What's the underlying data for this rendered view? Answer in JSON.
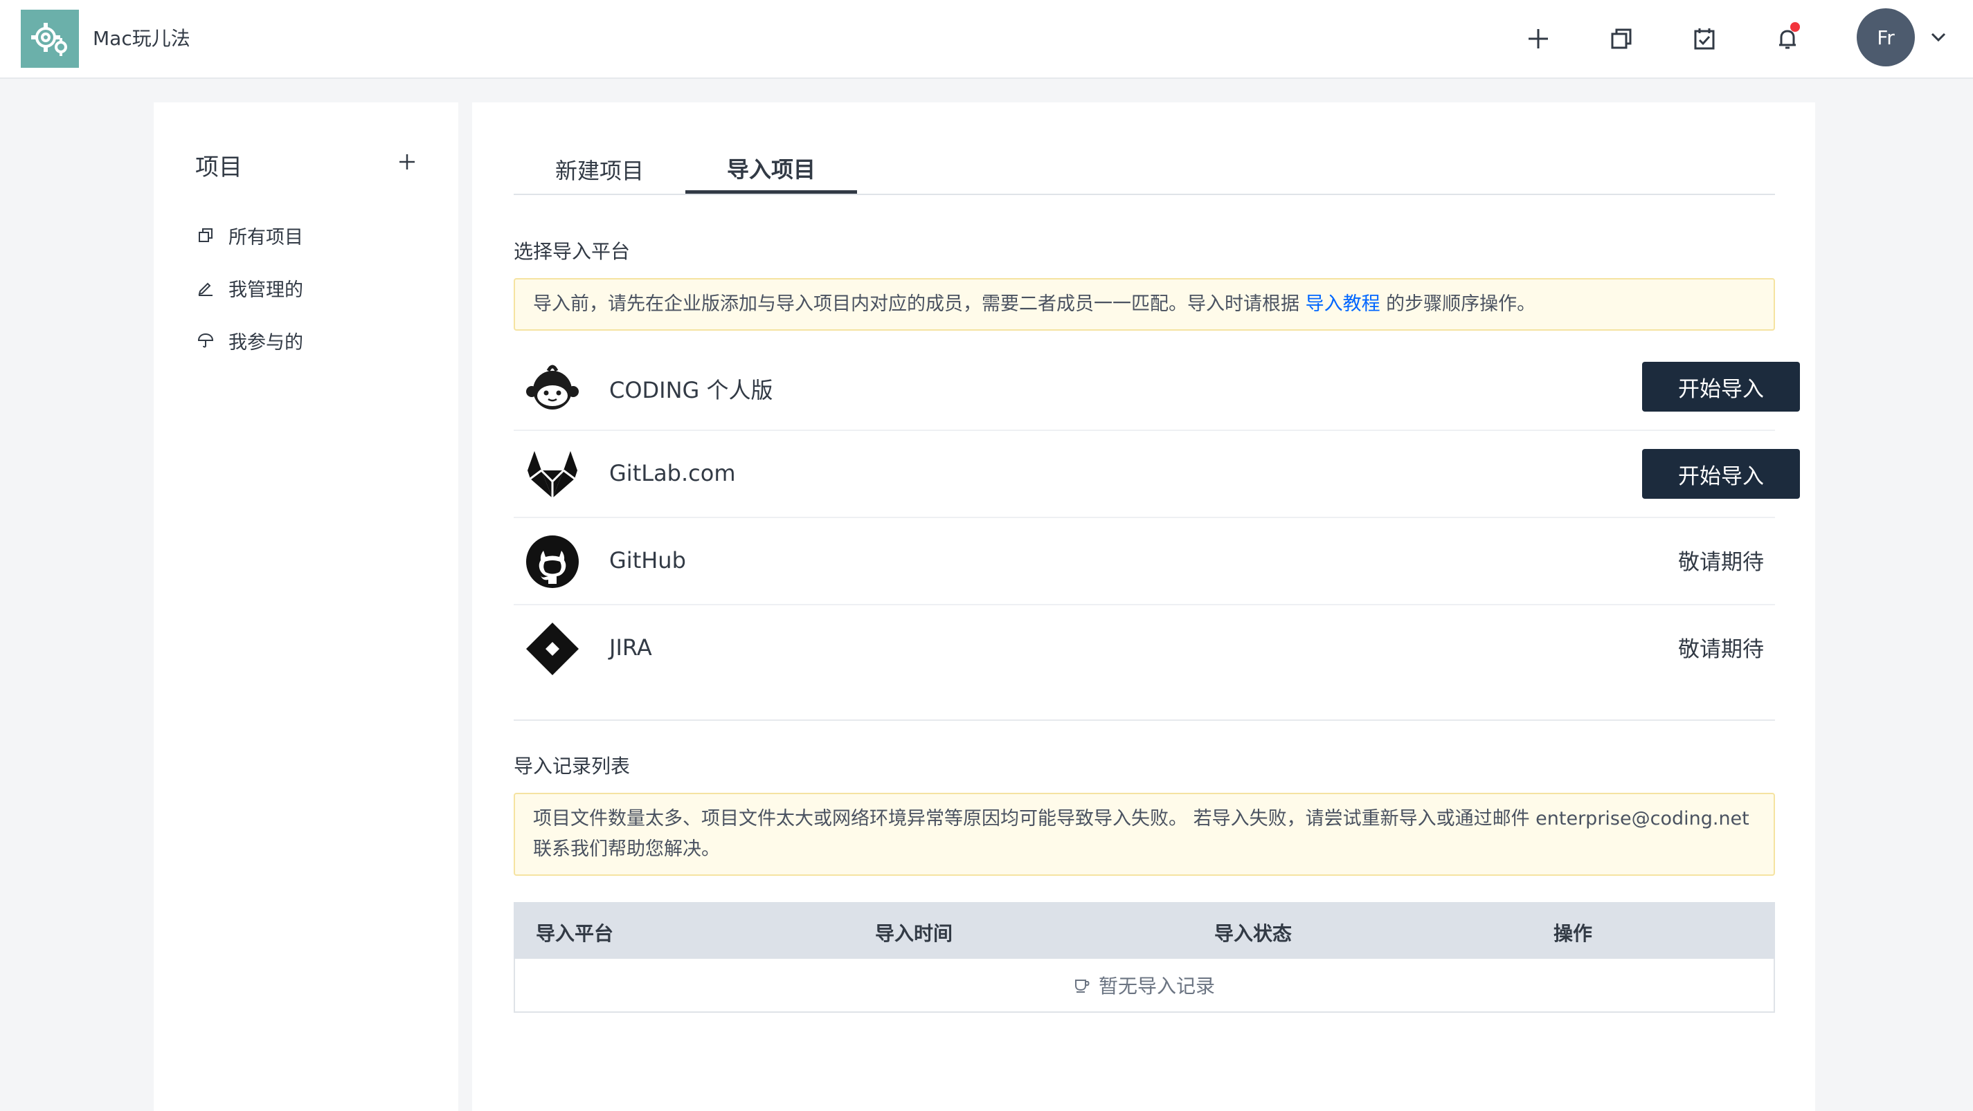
{
  "app": {
    "brand_name": "Mac玩儿法",
    "logo_icon": "gear-cluster-icon",
    "accent_color": "#1c2b3d",
    "link_color": "#0066ff"
  },
  "topbar": {
    "icons": [
      "plus-icon",
      "copy-icon",
      "calendar-check-icon",
      "bell-icon"
    ],
    "avatar_initials": "Fr"
  },
  "sidebar": {
    "title": "项目",
    "items": [
      {
        "label": "所有项目",
        "icon": "copy-icon"
      },
      {
        "label": "我管理的",
        "icon": "pen-icon"
      },
      {
        "label": "我参与的",
        "icon": "umbrella-icon"
      }
    ]
  },
  "main": {
    "tabs": [
      {
        "label": "新建项目",
        "active": false
      },
      {
        "label": "导入项目",
        "active": true
      }
    ],
    "select_platform_title": "选择导入平台",
    "notice1": {
      "before": "导入前，请先在企业版添加与导入项目内对应的成员，需要二者成员一一匹配。导入时请根据 ",
      "link": "导入教程",
      "after": " 的步骤顺序操作。"
    },
    "platforms": [
      {
        "name": "CODING 个人版",
        "icon": "coding-monkey-icon",
        "action": "开始导入",
        "available": true
      },
      {
        "name": "GitLab.com",
        "icon": "gitlab-icon",
        "action": "开始导入",
        "available": true
      },
      {
        "name": "GitHub",
        "icon": "github-icon",
        "action": "敬请期待",
        "available": false
      },
      {
        "name": "JIRA",
        "icon": "jira-icon",
        "action": "敬请期待",
        "available": false
      }
    ],
    "records_title": "导入记录列表",
    "notice2": "项目文件数量太多、项目文件太大或网络环境异常等原因均可能导致导入失败。 若导入失败，请尝试重新导入或通过邮件 enterprise@coding.net 联系我们帮助您解决。",
    "table": {
      "headers": [
        "导入平台",
        "导入时间",
        "导入状态",
        "操作"
      ],
      "empty_text": "暂无导入记录"
    }
  }
}
